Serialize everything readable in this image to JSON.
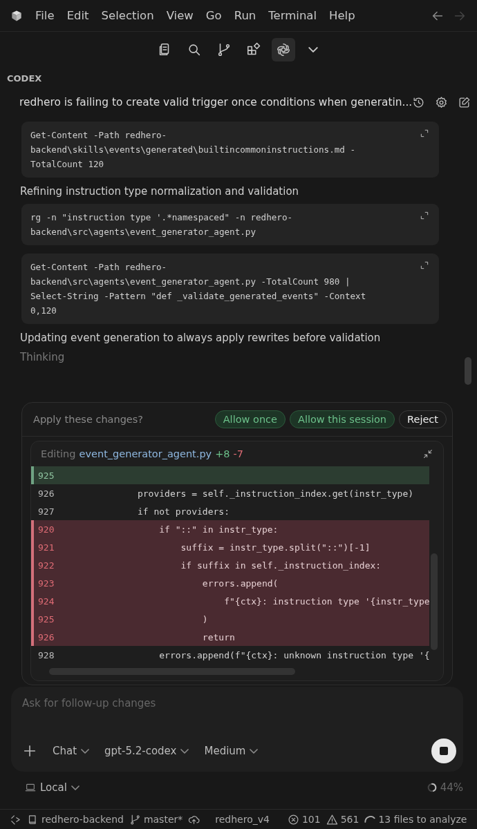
{
  "menu": {
    "items": [
      "File",
      "Edit",
      "Selection",
      "View",
      "Go",
      "Run",
      "Terminal",
      "Help"
    ]
  },
  "toolbar": {
    "items": [
      {
        "kind": "files",
        "selected": false
      },
      {
        "kind": "search",
        "selected": false
      },
      {
        "kind": "branch",
        "selected": false
      },
      {
        "kind": "extensions",
        "selected": false
      },
      {
        "kind": "codex",
        "selected": true
      },
      {
        "kind": "more",
        "selected": false
      }
    ]
  },
  "panel": {
    "label": "CODEX",
    "title": "redhero is failing to create valid trigger once conditions when generatin..."
  },
  "log": [
    {
      "kind": "code",
      "lines": [
        "Get-Content -Path redhero-",
        "backend\\skills\\events\\generated\\builtincommoninstructions.md -",
        "TotalCount 120"
      ]
    },
    {
      "kind": "step",
      "text": "Refining instruction type normalization and validation"
    },
    {
      "kind": "code",
      "lines": [
        "rg -n \"instruction type '.*namespaced\" -n redhero-",
        "backend\\src\\agents\\event_generator_agent.py"
      ]
    },
    {
      "kind": "code",
      "lines": [
        "Get-Content -Path redhero-",
        "backend\\src\\agents\\event_generator_agent.py -TotalCount 980 |",
        "Select-String -Pattern \"def _validate_generated_events\" -Context",
        "0,120"
      ]
    },
    {
      "kind": "step",
      "text": "Updating event generation to always apply rewrites before validation"
    },
    {
      "kind": "status",
      "text": "Thinking"
    }
  ],
  "approval": {
    "prompt": "Apply these changes?",
    "buttons": [
      {
        "label": "Allow once",
        "kind": "allow"
      },
      {
        "label": "Allow this session",
        "kind": "allow"
      },
      {
        "label": "Reject",
        "kind": "reject"
      }
    ],
    "diff": {
      "verb": "Editing",
      "file": "event_generator_agent.py",
      "added": "+8",
      "removed": "-7",
      "lines": [
        {
          "num": "925",
          "kind": "added"
        },
        {
          "num": "926",
          "kind": "context",
          "code": "            providers = self._instruction_index.get(instr_type)"
        },
        {
          "num": "927",
          "kind": "context",
          "code": "            if not providers:"
        },
        {
          "num": "920",
          "kind": "removed",
          "code": "                if \"::\" in instr_type:"
        },
        {
          "num": "921",
          "kind": "removed",
          "code": "                    suffix = instr_type.split(\"::\")[-1]"
        },
        {
          "num": "922",
          "kind": "removed",
          "code": "                    if suffix in self._instruction_index:"
        },
        {
          "num": "923",
          "kind": "removed",
          "code": "                        errors.append("
        },
        {
          "num": "924",
          "kind": "removed",
          "code": "                            f\"{ctx}: instruction type '{instr_type"
        },
        {
          "num": "925",
          "kind": "removed",
          "code": "                        )"
        },
        {
          "num": "926",
          "kind": "removed",
          "code": "                        return"
        },
        {
          "num": "928",
          "kind": "context",
          "code": "                errors.append(f\"{ctx}: unknown instruction type '{"
        }
      ]
    }
  },
  "composer": {
    "placeholder": "Ask for follow-up changes",
    "mode": "Chat",
    "model": "gpt-5.2-codex",
    "effort": "Medium"
  },
  "environment": {
    "label": "Local",
    "usage": "44%"
  },
  "status_bar": {
    "items": [
      {
        "kind": "remote"
      },
      {
        "kind": "repo",
        "text": "redhero-backend"
      },
      {
        "kind": "branch",
        "text": "master*"
      },
      {
        "kind": "sync"
      },
      {
        "kind": "text",
        "text": "redhero_v4"
      },
      {
        "kind": "errors",
        "text": "101"
      },
      {
        "kind": "warnings",
        "text": "561"
      },
      {
        "kind": "progress",
        "text": "13 files to analyze"
      }
    ]
  }
}
